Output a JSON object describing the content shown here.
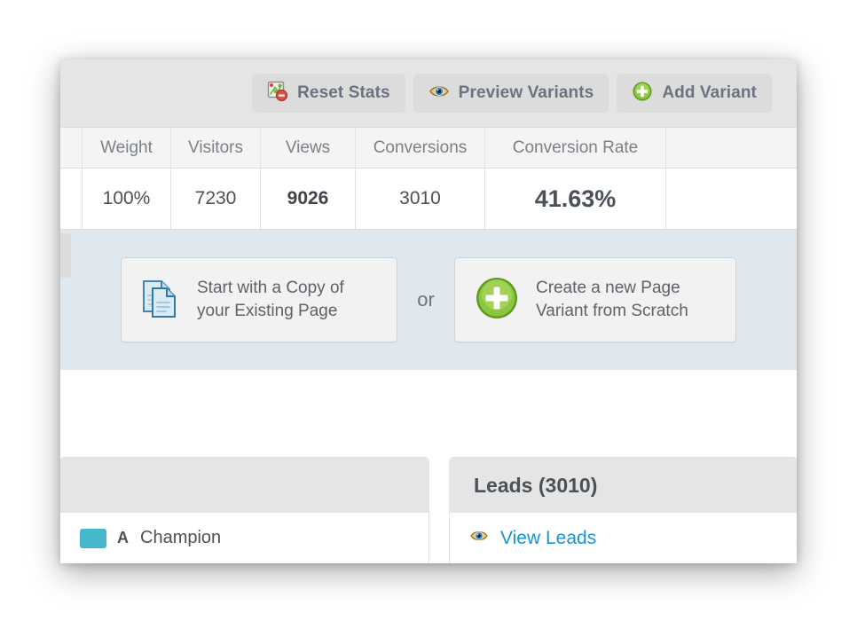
{
  "toolbar": {
    "buttons": [
      {
        "label": "Reset Stats",
        "icon": "reset-stats-icon"
      },
      {
        "label": "Preview Variants",
        "icon": "eye-icon"
      },
      {
        "label": "Add Variant",
        "icon": "plus-circle-icon"
      }
    ]
  },
  "stats_table": {
    "columns": [
      "Weight",
      "Visitors",
      "Views",
      "Conversions",
      "Conversion Rate",
      ""
    ],
    "rows": [
      {
        "weight": "100%",
        "visitors": "7230",
        "views": "9026",
        "conversions": "3010",
        "conversion_rate": "41.63%",
        "tail": ""
      }
    ]
  },
  "create_variant": {
    "copy_option": {
      "line1": "Start with a Copy of",
      "line2": "your Existing Page",
      "icon": "copy-pages-icon"
    },
    "separator": "or",
    "scratch_option": {
      "line1": "Create a new Page",
      "line2": "Variant from Scratch",
      "icon": "plus-circle-icon"
    }
  },
  "cards": {
    "variants_card": {
      "title": "",
      "rows": [
        {
          "letter": "A",
          "name": "Champion",
          "color": "#45b7ca"
        }
      ]
    },
    "leads_card": {
      "title": "Leads (3010)",
      "link": "View Leads",
      "link_icon": "eye-icon",
      "link_color": "#1a93d4"
    }
  }
}
